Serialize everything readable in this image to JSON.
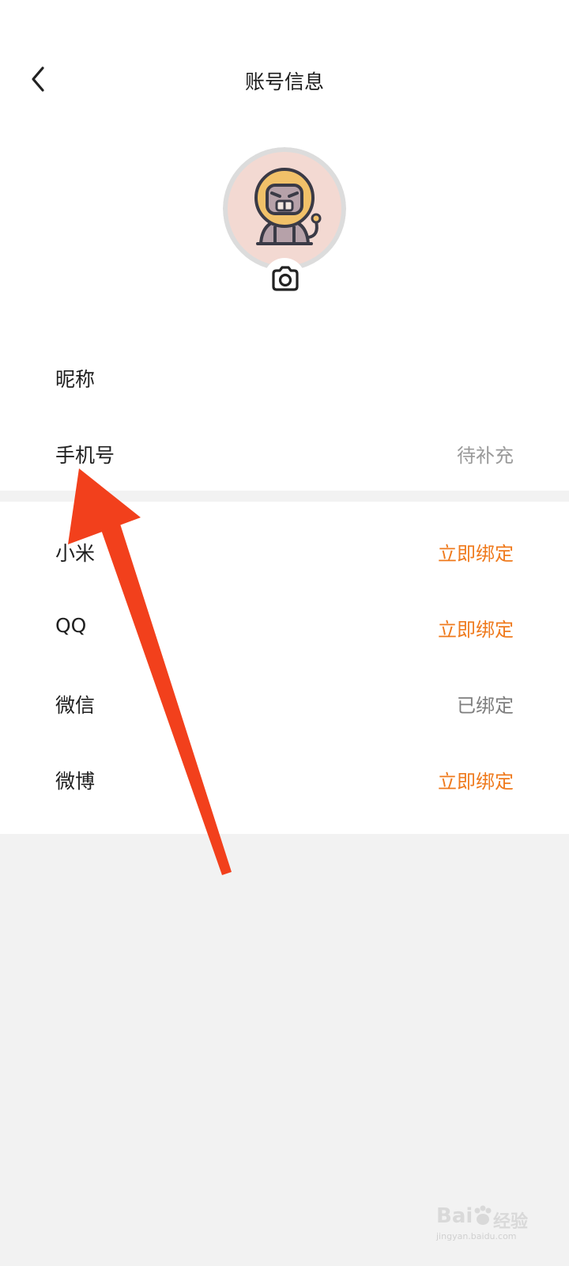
{
  "header": {
    "title": "账号信息",
    "back_icon": "chevron-left-icon"
  },
  "avatar": {
    "icon": "lion-avatar-icon",
    "bg_color": "#f3d9d2",
    "ring_color": "#dcdcdc",
    "camera_icon": "camera-icon"
  },
  "profile_rows": [
    {
      "label": "昵称",
      "value": ""
    },
    {
      "label": "手机号",
      "value": "待补充"
    }
  ],
  "bind_rows": [
    {
      "label": "小米",
      "value": "立即绑定"
    },
    {
      "label": "QQ",
      "value": "立即绑定"
    },
    {
      "label": "微信",
      "value": "已绑定"
    },
    {
      "label": "微博",
      "value": "立即绑定"
    }
  ],
  "colors": {
    "accent": "#ef7a1d",
    "annotation_arrow": "#f2401c",
    "page_bg": "#f2f2f2"
  },
  "annotation": {
    "icon": "red-arrow-annotation"
  },
  "watermark": {
    "brand": "Bai",
    "brand2": "经验",
    "url": "jingyan.baidu.com"
  }
}
